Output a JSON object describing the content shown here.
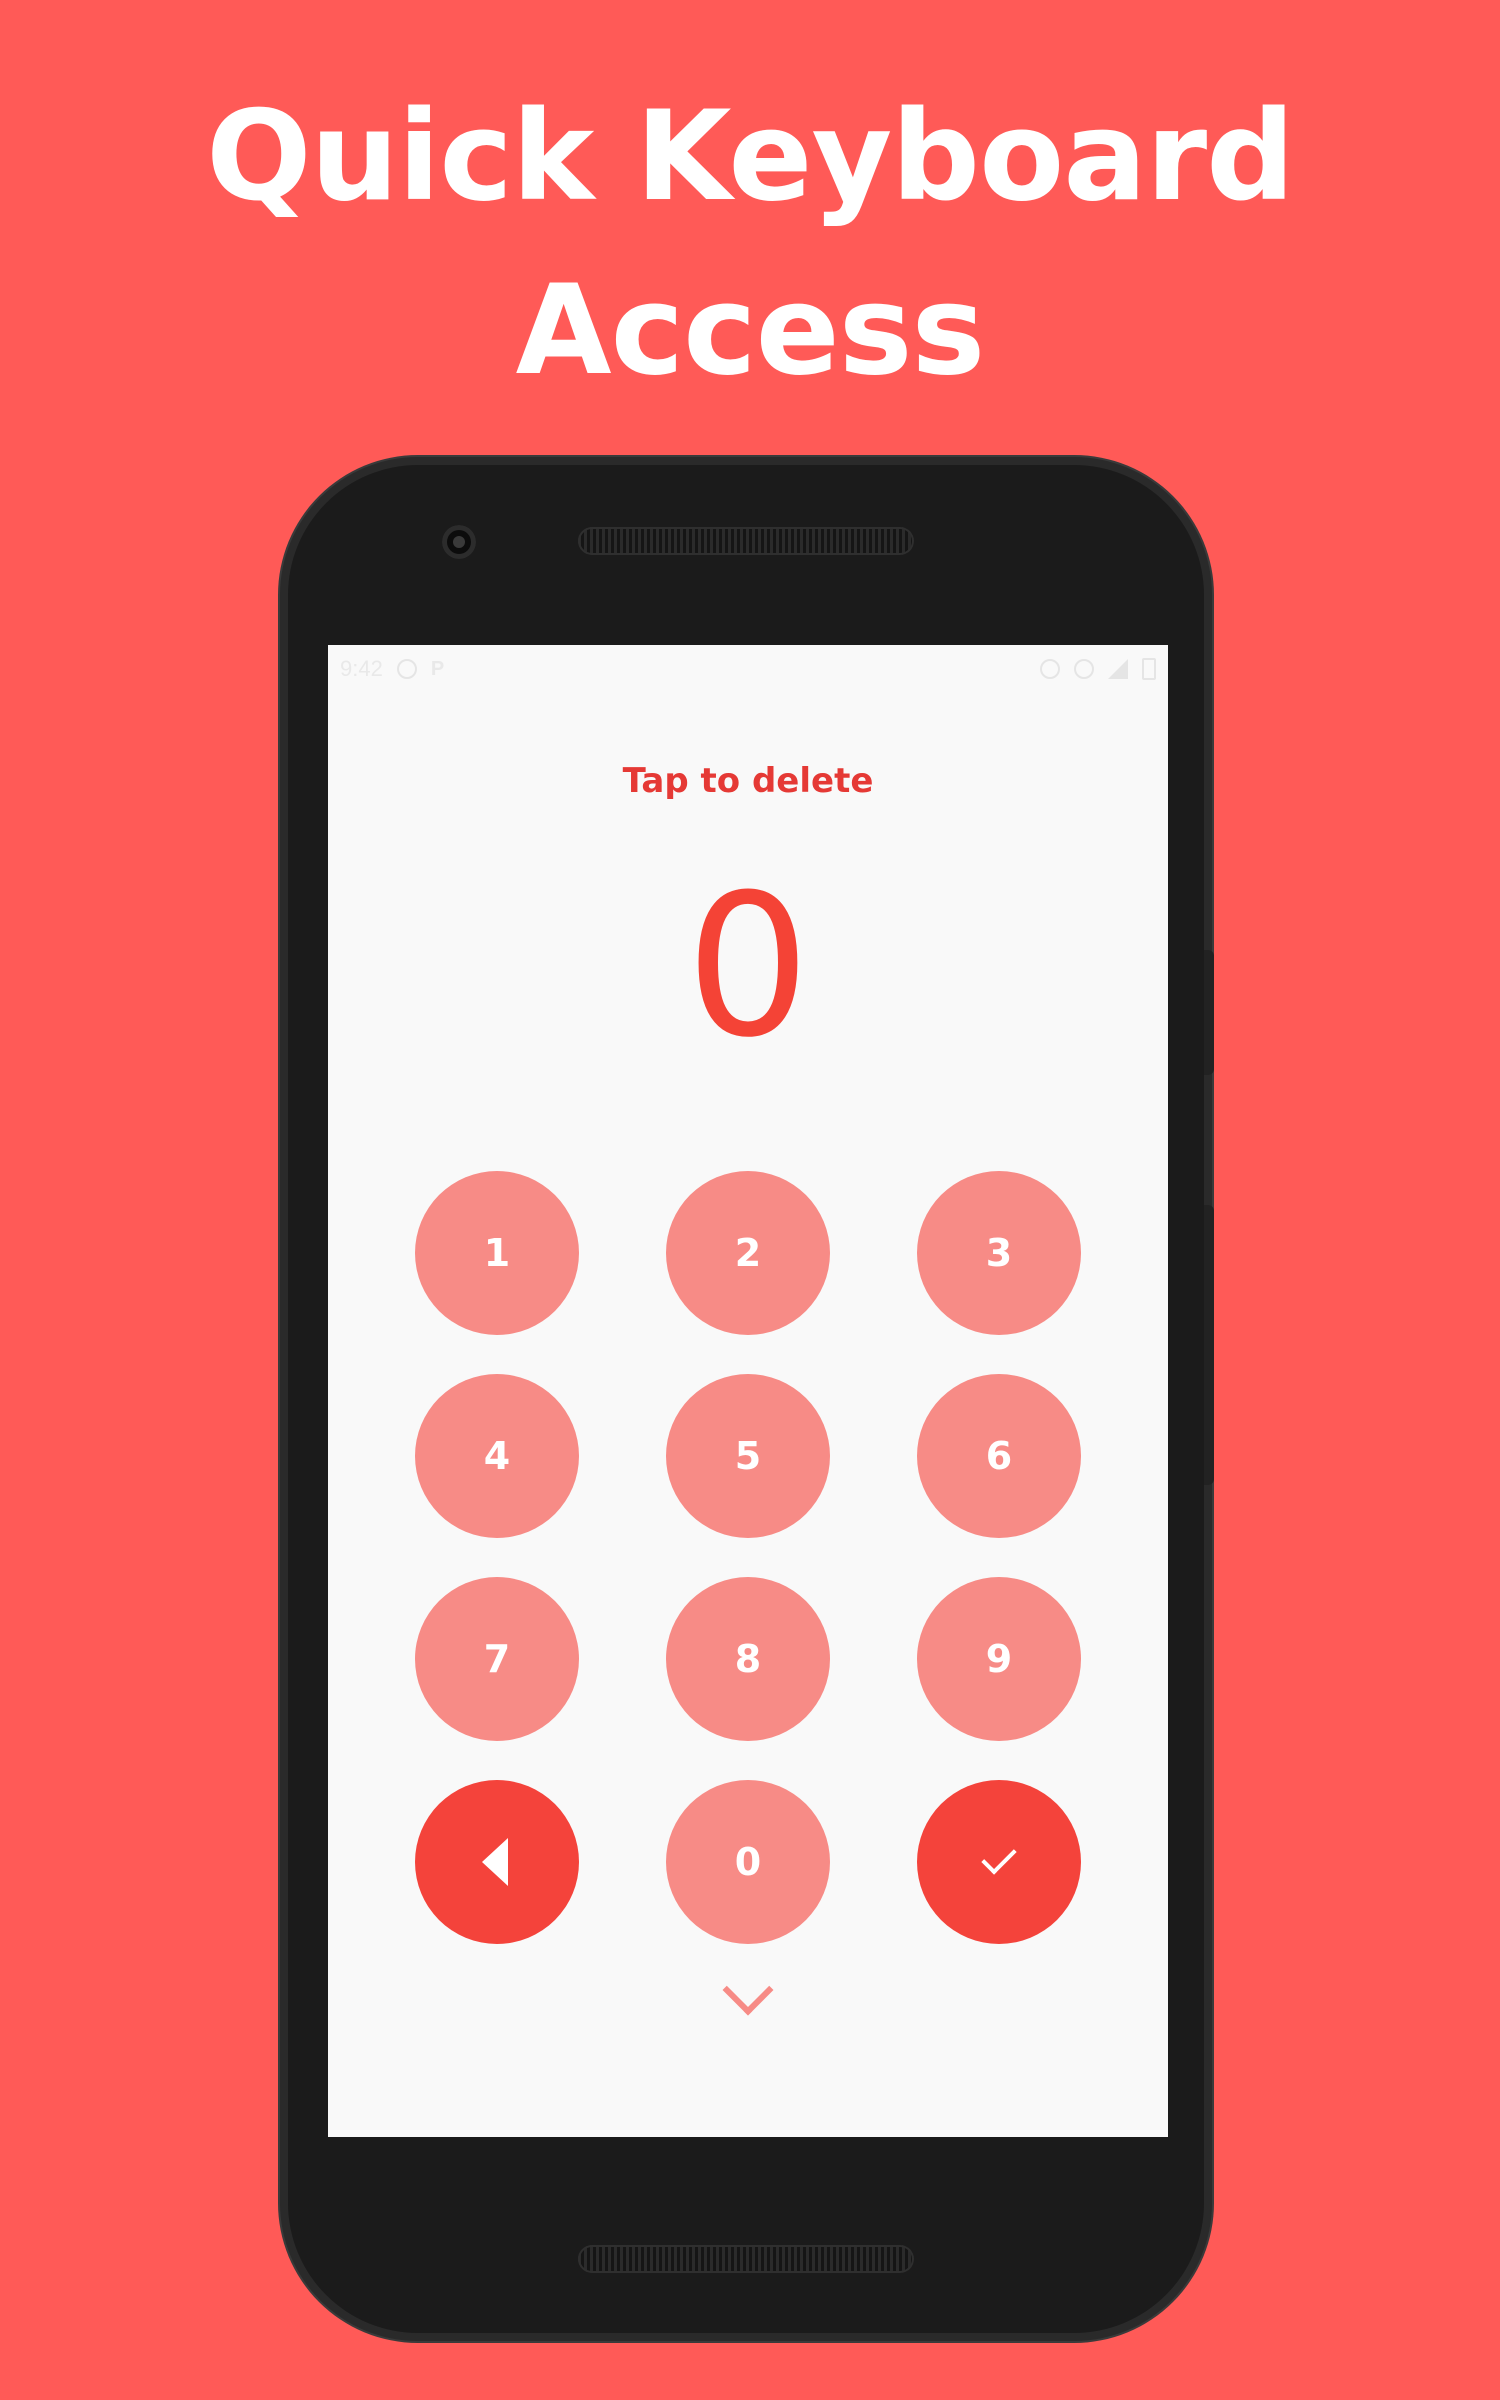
{
  "headline": {
    "line1": "Quick Keyboard",
    "line2": "Access"
  },
  "status_bar": {
    "time": "9:42",
    "left_icons": [
      "smiley-icon",
      "p-icon"
    ],
    "right_icons": [
      "alarm-icon",
      "vibrate-icon",
      "signal-icon",
      "battery-icon"
    ]
  },
  "screen": {
    "hint": "Tap to delete",
    "display_value": "0"
  },
  "keypad": {
    "keys": [
      "1",
      "2",
      "3",
      "4",
      "5",
      "6",
      "7",
      "8",
      "9",
      "0"
    ],
    "backspace_icon": "backspace-icon",
    "confirm_icon": "check-icon",
    "collapse_icon": "chevron-down-icon"
  },
  "colors": {
    "background": "#FF5A57",
    "key": "#F78B86",
    "action_key": "#F4433B",
    "accent": "#F44336"
  }
}
